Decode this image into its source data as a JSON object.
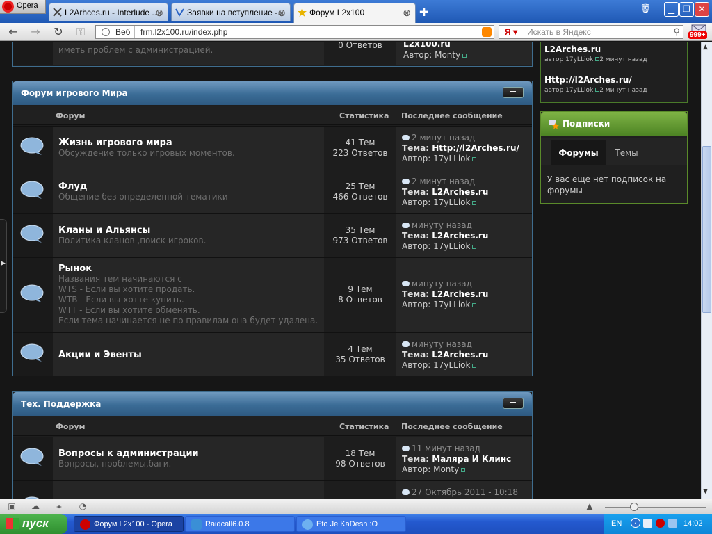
{
  "browser": {
    "menu_label": "Opera",
    "tabs": [
      {
        "label": "L2Arhces.ru - Interlude ..."
      },
      {
        "label": "Заявки на вступление -..."
      },
      {
        "label": "Форум L2x100"
      }
    ],
    "web_label": "Веб",
    "url": "frm.l2x100.ru/index.php",
    "search_logo": "Я",
    "search_placeholder": "Искать в Яндекс",
    "mail_badge": "999+"
  },
  "top_fragment": {
    "desc": "иметь проблем с администрацией.",
    "stats": "0 Ответов",
    "topic": "L2x100.ru",
    "author_prefix": "Автор:",
    "author": "Monty"
  },
  "columns": {
    "forum": "Форум",
    "stats": "Статистика",
    "last": "Последнее сообщение"
  },
  "labels": {
    "topic_prefix": "Тема:",
    "author_prefix": "Автор:"
  },
  "sections": [
    {
      "title": "Форум игрового Мира",
      "forums": [
        {
          "title": "Жизнь игрового мира",
          "desc": [
            "Обсуждение только игровых моментов."
          ],
          "topics": "41 Тем",
          "replies": "223 Ответов",
          "time": "2 минут назад",
          "topic": "Http://l2Arches.ru/",
          "author": "17yLLiok"
        },
        {
          "title": "Флуд",
          "desc": [
            "Общение без определенной тематики"
          ],
          "topics": "25 Тем",
          "replies": "466 Ответов",
          "time": "2 минут назад",
          "topic": "L2Arches.ru",
          "author": "17yLLiok"
        },
        {
          "title": "Кланы и Альянсы",
          "desc": [
            "Политика кланов ,поиск игроков."
          ],
          "topics": "35 Тем",
          "replies": "973 Ответов",
          "time": "минуту назад",
          "topic": "L2Arches.ru",
          "author": "17yLLiok"
        },
        {
          "title": "Рынок",
          "desc": [
            "Названия тем начинаются с",
            "WTS - Если вы хотите продать.",
            "WTB - Если вы хотте купить.",
            "WTT - Если вы хотите обменять.",
            "Если тема начинается не по правилам она будет удалена."
          ],
          "topics": "9 Тем",
          "replies": "8 Ответов",
          "time": "минуту назад",
          "topic": "L2Arches.ru",
          "author": "17yLLiok"
        },
        {
          "title": "Акции и Эвенты",
          "desc": [],
          "topics": "4 Тем",
          "replies": "35 Ответов",
          "time": "минуту назад",
          "topic": "L2Arches.ru",
          "author": "17yLLiok"
        }
      ]
    },
    {
      "title": "Тех. Поддержка",
      "forums": [
        {
          "title": "Вопросы к администрации",
          "desc": [
            "Вопросы, проблемы,баги."
          ],
          "topics": "18 Тем",
          "replies": "98 Ответов",
          "time": "11 минут назад",
          "topic": "Маляра И Клинс",
          "author": "Monty"
        },
        {
          "title": "",
          "desc": [],
          "topics": "",
          "replies": "",
          "time": "27 Октябрь 2011 - 10:18",
          "topic": "",
          "author": ""
        }
      ]
    }
  ],
  "sidebar": {
    "recent": [
      {
        "title": "L2Arches.ru",
        "by": "автор",
        "author": "17yLLiok",
        "time": "2 минут назад"
      },
      {
        "title": "Http://l2Arches.ru/",
        "by": "автор",
        "author": "17yLLiok",
        "time": "2 минут назад"
      }
    ],
    "subs_title": "Подписки",
    "subs_tabs": [
      "Форумы",
      "Темы"
    ],
    "subs_empty": "У вас еще нет подписок на форумы"
  },
  "taskbar": {
    "start": "пуск",
    "tasks": [
      {
        "label": "Форум L2x100 - Opera"
      },
      {
        "label": "Raidcall6.0.8"
      },
      {
        "label": "Eto Je KaDesh :O"
      }
    ],
    "lang": "EN",
    "clock": "14:02"
  },
  "colors": {
    "panel_head": "#3b6c96",
    "green_head": "#5f9630",
    "bg": "#161616"
  }
}
